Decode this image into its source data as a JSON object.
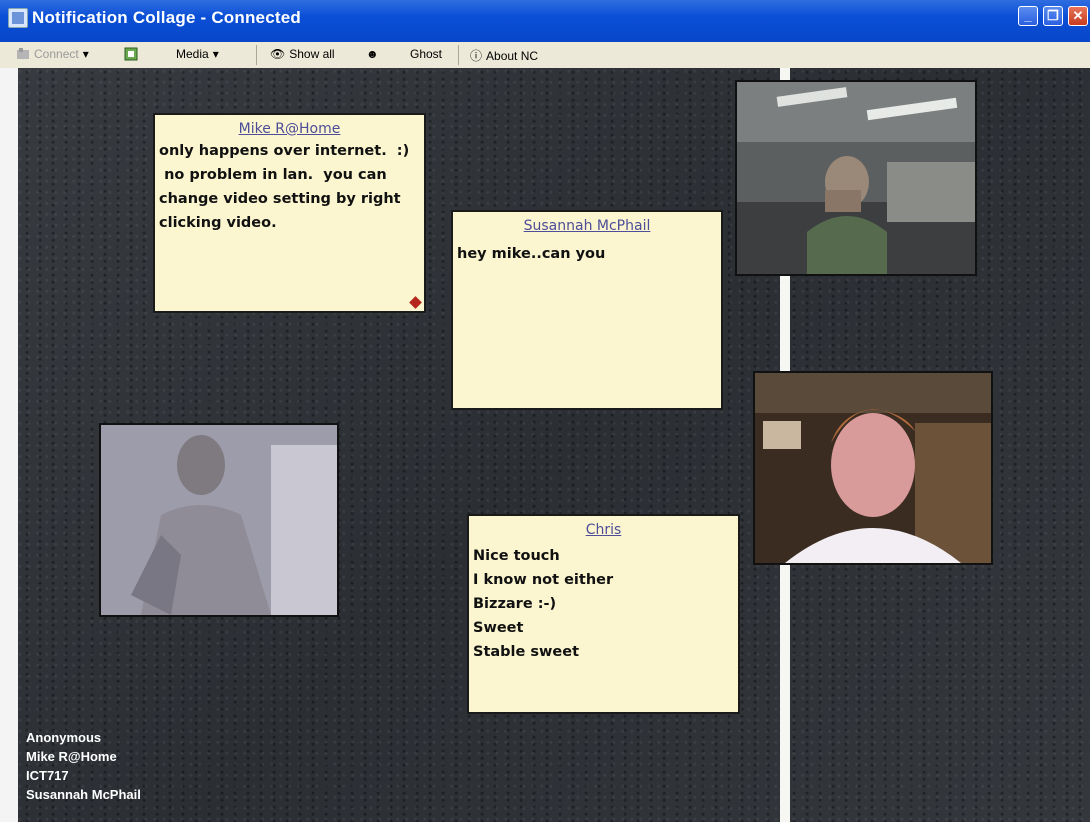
{
  "window": {
    "title": "Notification Collage - Connected"
  },
  "toolbar": {
    "connect_label": "Connect",
    "media_label": "Media",
    "show_all_label": "Show all",
    "ghost_label": "Ghost",
    "about_label": "About NC"
  },
  "notes": [
    {
      "author": "Mike R@Home",
      "body": "only happens over internet.  :)\n no problem in lan.  you can\nchange video setting by right\nclicking video."
    },
    {
      "author": "Susannah McPhail",
      "body": "hey mike..can you"
    },
    {
      "author": "Chris",
      "body": "Nice touch\nI know not either\nBizzare :-)\nSweet\nStable sweet"
    }
  ],
  "roster": [
    "Anonymous",
    "Mike R@Home",
    "ICT717",
    "Susannah McPhail"
  ],
  "colors": {
    "titlebar": "#0a4fd6",
    "note_bg": "#fbf6cf",
    "note_author": "#4d4d9a",
    "canvas": "#2f3338"
  }
}
